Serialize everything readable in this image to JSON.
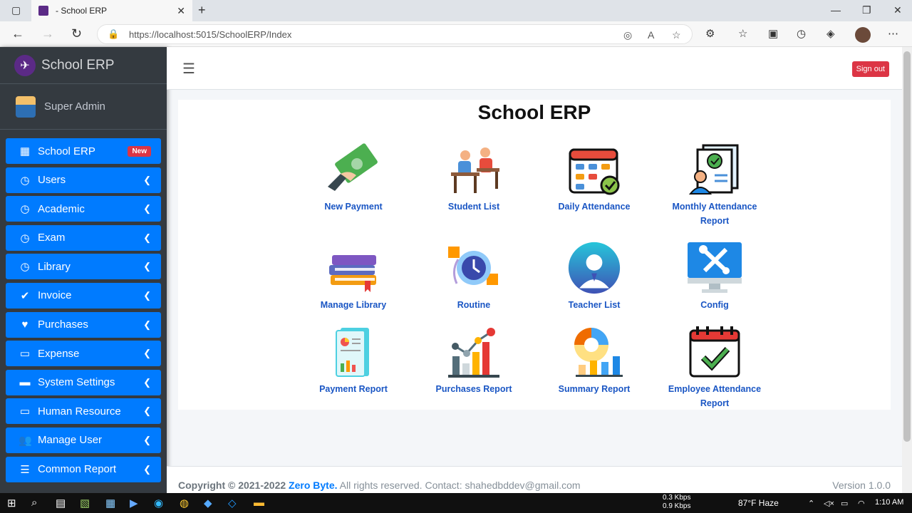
{
  "browser": {
    "tab_title": "- School ERP",
    "url": "https://localhost:5015/SchoolERP/Index"
  },
  "sidebar": {
    "brand": "School ERP",
    "user": "Super Admin",
    "items": [
      {
        "label": "School ERP",
        "icon": "grid-icon",
        "badge": "New"
      },
      {
        "label": "Users",
        "icon": "clock-icon"
      },
      {
        "label": "Academic",
        "icon": "clock-icon"
      },
      {
        "label": "Exam",
        "icon": "clock-icon"
      },
      {
        "label": "Library",
        "icon": "clock-icon"
      },
      {
        "label": "Invoice",
        "icon": "check-circle-icon"
      },
      {
        "label": "Purchases",
        "icon": "heart-icon"
      },
      {
        "label": "Expense",
        "icon": "monitor-icon"
      },
      {
        "label": "System Settings",
        "icon": "toolbox-icon"
      },
      {
        "label": "Human Resource",
        "icon": "monitor-icon"
      },
      {
        "label": "Manage User",
        "icon": "user-cog-icon"
      },
      {
        "label": "Common Report",
        "icon": "database-icon"
      }
    ]
  },
  "header": {
    "signout": "Sign out"
  },
  "main": {
    "title": "School ERP",
    "tiles": [
      {
        "label": "New Payment",
        "icon": "money-icon"
      },
      {
        "label": "Student List",
        "icon": "students-icon"
      },
      {
        "label": "Daily Attendance",
        "icon": "calendar-check-icon"
      },
      {
        "label": "Monthly Attendance Report",
        "icon": "report-user-icon"
      },
      {
        "label": "Manage Library",
        "icon": "books-icon"
      },
      {
        "label": "Routine",
        "icon": "routine-clock-icon"
      },
      {
        "label": "Teacher List",
        "icon": "teacher-icon"
      },
      {
        "label": "Config",
        "icon": "tools-monitor-icon"
      },
      {
        "label": "Payment Report",
        "icon": "payment-report-icon"
      },
      {
        "label": "Purchases Report",
        "icon": "bar-chart-icon"
      },
      {
        "label": "Summary Report",
        "icon": "pie-chart-icon"
      },
      {
        "label": "Employee Attendance Report",
        "icon": "calendar-tick-icon"
      }
    ]
  },
  "footer": {
    "copyright": "Copyright © 2021-2022",
    "company": "Zero Byte.",
    "rights": " All rights reserved. Contact: shahedbddev@gmail.com",
    "version": "Version 1.0.0"
  },
  "taskbar": {
    "net_up": "0.3 Kbps",
    "net_down": "0.9 Kbps",
    "weather": "87°F  Haze",
    "time": "1:10 AM"
  },
  "colors": {
    "sidebar_bg": "#343a40",
    "menu_item": "#007bff",
    "badge": "#dc3545",
    "tile_label": "#1a56c4"
  }
}
